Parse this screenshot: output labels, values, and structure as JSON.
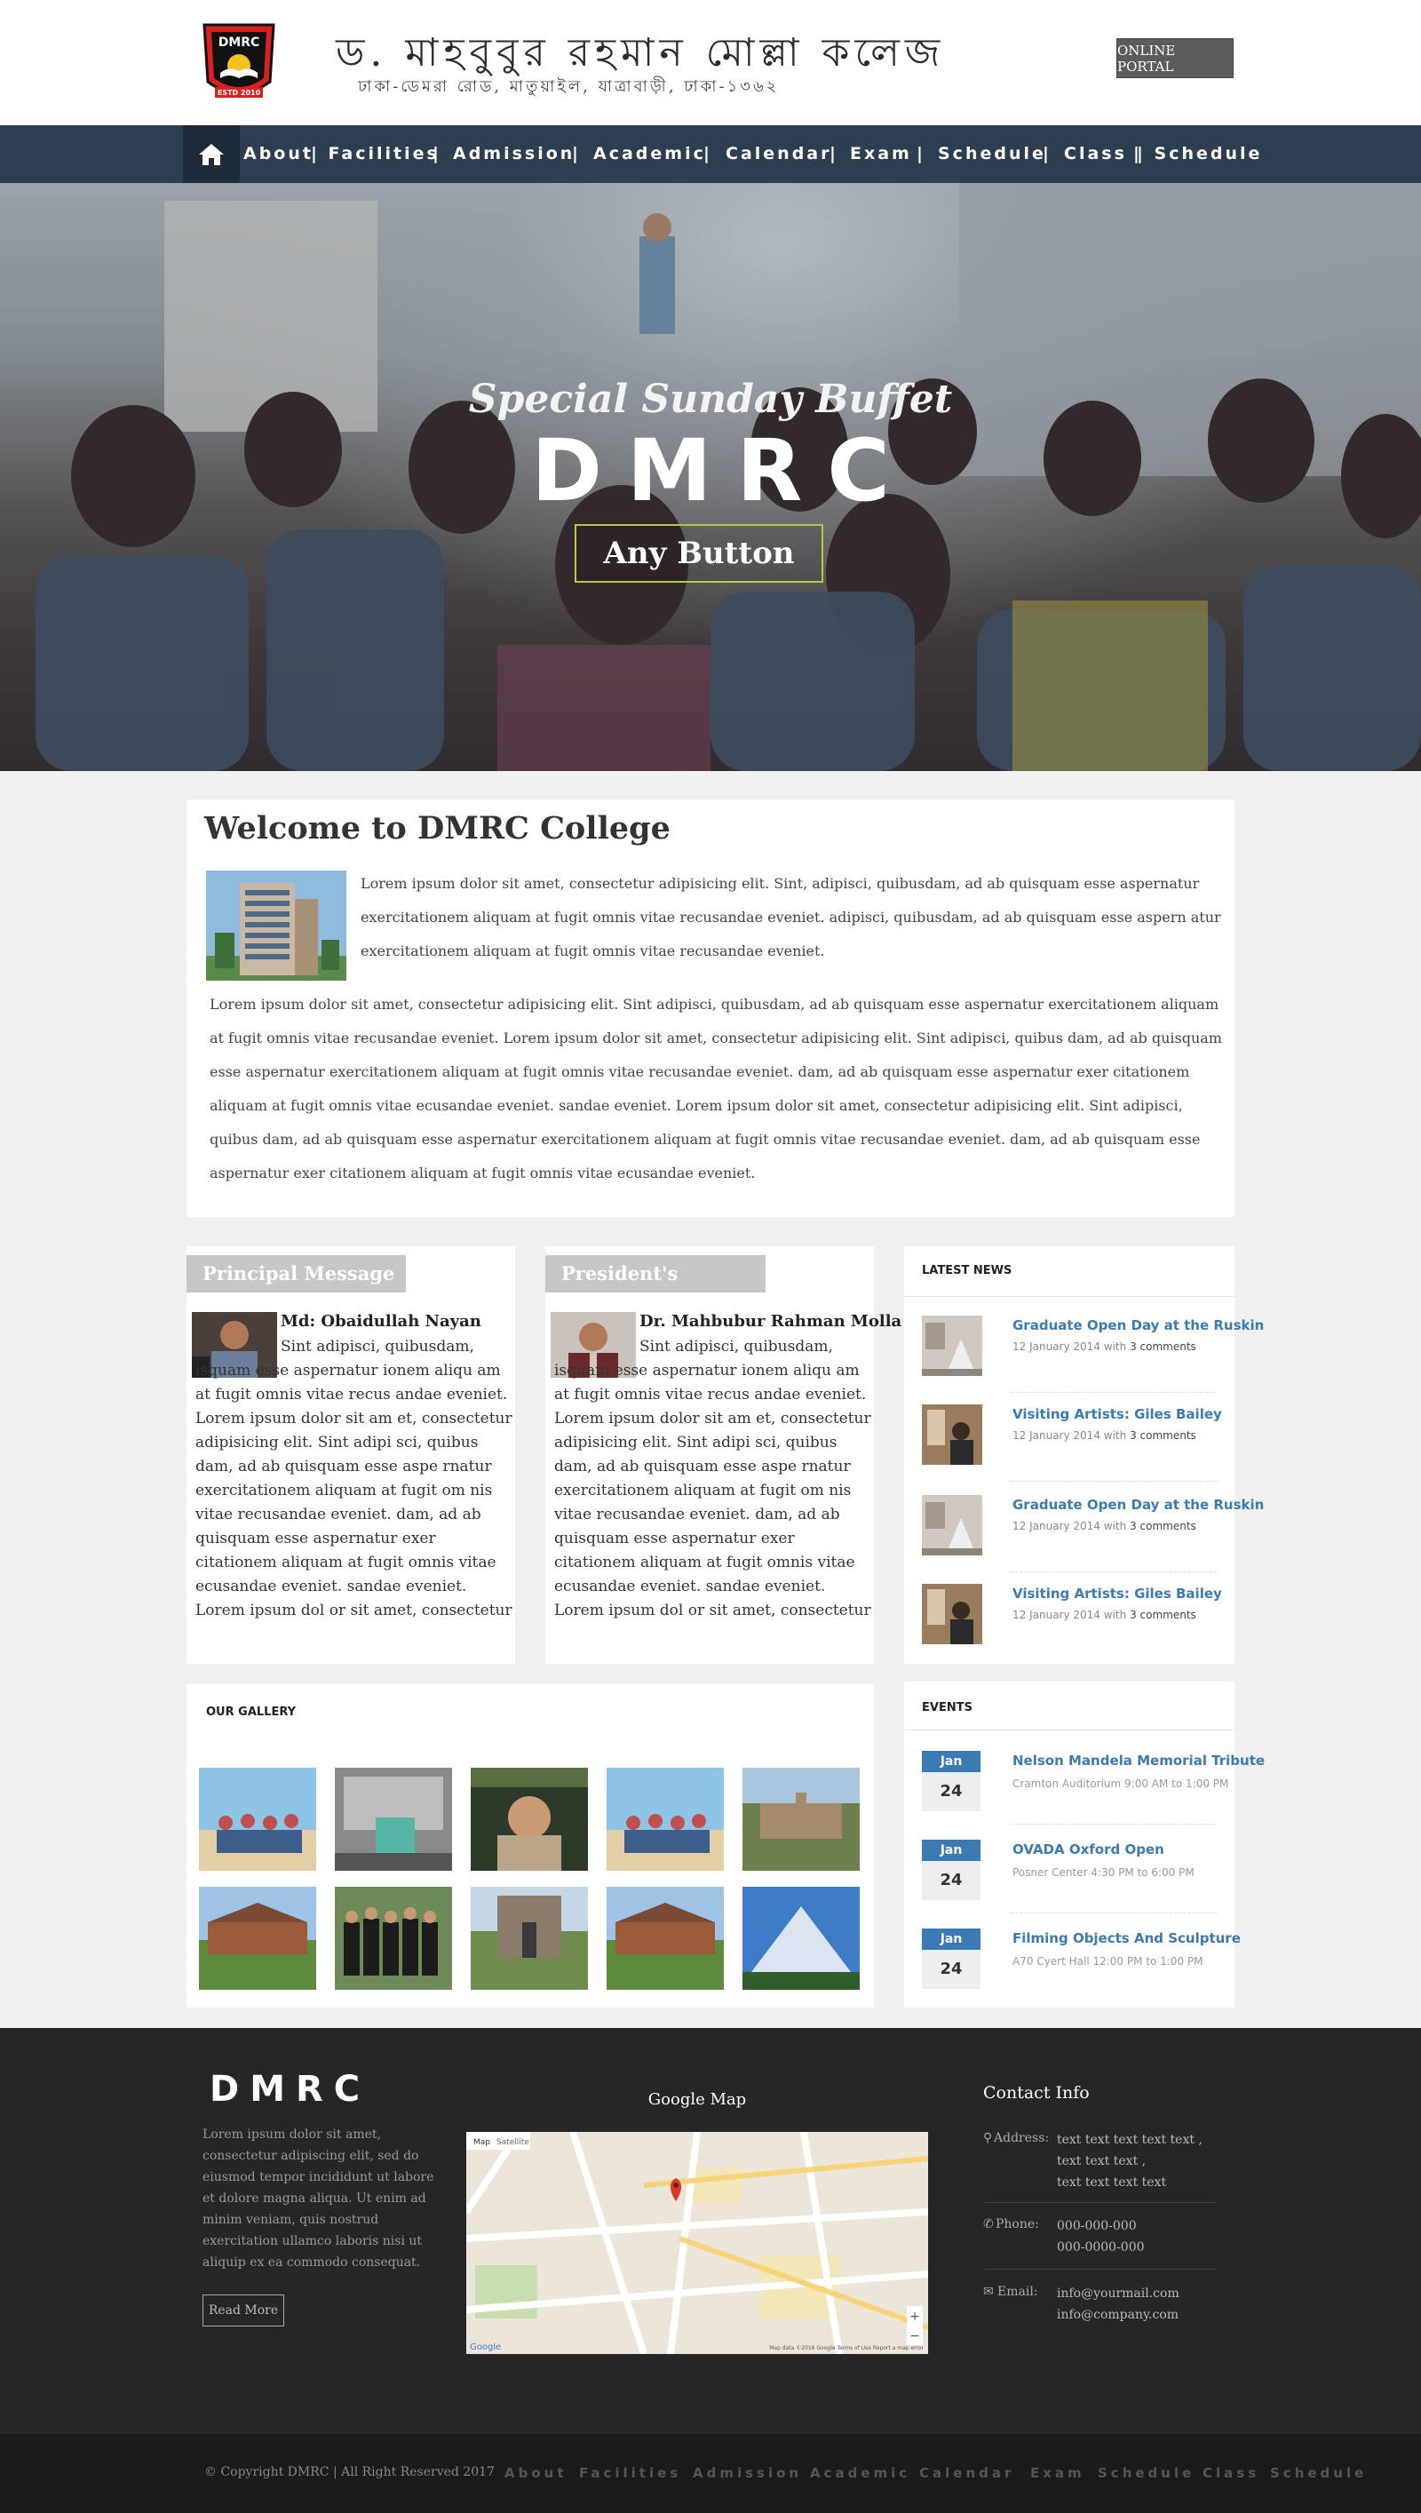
{
  "header": {
    "college_name_bn": "ড. মাহবুবুর রহমান মোল্লা কলেজ",
    "address_bn": "ঢাকা-ডেমরা রোড, মাতুয়াইল, যাত্রাবাড়ী, ঢাকা-১৩৬২",
    "logo": {
      "text": "DMRC",
      "estd": "ESTD 2010"
    },
    "portal_button": "ONLINE PORTAL"
  },
  "nav": {
    "home_icon": "home-icon",
    "items": [
      "About",
      "| Facilities",
      "|",
      "Admission",
      "|",
      "Academic",
      "|",
      "Calendar",
      "|",
      "Exam",
      "|",
      "Schedule",
      "|",
      "Class",
      "|",
      "| Schedule"
    ]
  },
  "hero": {
    "subtitle": "Special Sunday Buffet",
    "title": "DMRC",
    "button": "Any Button"
  },
  "welcome": {
    "title": "Welcome to DMRC College",
    "para1": "Lorem ipsum dolor sit amet, consectetur adipisicing elit. Sint, adipisci, quibusdam, ad ab quisquam esse aspernatur exercitationem aliquam at fugit omnis vitae recusandae eveniet. adipisci, quibusdam, ad ab quisquam esse aspern atur exercitationem aliquam at fugit omnis vitae recusandae eveniet.",
    "para2": "Lorem ipsum dolor sit amet, consectetur adipisicing elit. Sint adipisci, quibusdam, ad ab quisquam esse aspernatur exercitationem aliquam at fugit omnis vitae recusandae eveniet. Lorem ipsum dolor sit amet, consectetur adipisicing elit. Sint adipisci, quibus dam, ad ab quisquam esse aspernatur exercitationem aliquam at fugit omnis vitae  recusandae eveniet. dam, ad ab quisquam esse aspernatur exer citationem aliquam at  fugit omnis vitae ecusandae eveniet. sandae eveniet. Lorem ipsum dolor sit amet, consectetur adipisicing elit. Sint adipisci, quibus dam, ad ab quisquam esse aspernatur exercitationem aliquam at fugit omnis vitae  recusandae eveniet. dam, ad ab quisquam esse aspernatur exer citationem aliquam at  fugit omnis vitae ecusandae eveniet."
  },
  "principal": {
    "tab": "Principal Message",
    "name": "Md: Obaidullah Nayan",
    "text": "Sint adipisci, quibusdam, isquam esse aspernatur ionem aliqu am at fugit omnis vitae recus andae eveniet. Lorem ipsum dolor sit am et, consectetur adipisicing elit. Sint adipi sci, quibus dam, ad ab quisquam esse aspe rnatur exercitationem aliquam at fugit om nis vitae  recusandae eveniet. dam, ad ab quisquam esse aspernatur exer citationem aliquam at  fugit omnis vitae ecusandae eveniet. sandae eveniet. Lorem ipsum dol or sit amet, consectetur"
  },
  "president": {
    "tab": "President's message",
    "name": "Dr. Mahbubur Rahman Molla",
    "text": "Sint adipisci, quibusdam, isquam esse aspernatur ionem aliqu am at fugit omnis vitae recus andae eveniet. Lorem ipsum dolor sit am et, consectetur adipisicing elit. Sint adipi sci, quibus dam, ad ab quisquam esse aspe rnatur exercitationem aliquam at fugit om nis vitae  recusandae eveniet. dam, ad ab quisquam esse aspernatur exer citationem aliquam at  fugit omnis vitae ecusandae eveniet. sandae eveniet. Lorem ipsum dol or sit amet, consectetur"
  },
  "news": {
    "title": "LATEST NEWS",
    "items": [
      {
        "title": "Graduate Open Day at the Ruskin",
        "date": "12 January 2014",
        "with": "with",
        "comments": "3 comments"
      },
      {
        "title": "Visiting Artists: Giles Bailey",
        "date": "12 January 2014",
        "with": "with",
        "comments": "3 comments"
      },
      {
        "title": "Graduate Open Day at the Ruskin",
        "date": "12 January 2014",
        "with": "with",
        "comments": "3 comments"
      },
      {
        "title": "Visiting Artists: Giles Bailey",
        "date": "12 January 2014",
        "with": "with",
        "comments": "3 comments"
      }
    ]
  },
  "gallery": {
    "title": "OUR GALLERY"
  },
  "events": {
    "title": "EVENTS",
    "items": [
      {
        "month": "Jan",
        "day": "24",
        "title": "Nelson Mandela Memorial Tribute",
        "meta": "Cramton Auditorium 9:00 AM to 1:00 PM"
      },
      {
        "month": "Jan",
        "day": "24",
        "title": "OVADA Oxford Open",
        "meta": "Posner Center 4:30 PM to 6:00 PM"
      },
      {
        "month": "Jan",
        "day": "24",
        "title": "Filming Objects And Sculpture",
        "meta": "A70 Cyert Hall 12:00 PM to 1:00 PM"
      }
    ]
  },
  "footer": {
    "logo": "DMRC",
    "text": "Lorem ipsum dolor sit amet, consectetur adipiscing elit, sed do eiusmod tempor incididunt ut labore et dolore magna aliqua. Ut enim ad minim veniam, quis nostrud exercitation ullamco laboris nisi ut aliquip ex ea commodo consequat.",
    "read_more": "Read More",
    "map_title": "Google Map",
    "map_labels": {
      "map": "Map",
      "satellite": "Satellite",
      "google": "Google",
      "terms": "Map data ©2016 Google   Terms of Use   Report a map error"
    },
    "contact_title": "Contact Info",
    "address_label": "Address:",
    "address_lines": [
      "text text text text text ,",
      "text text text ,",
      "text text text text"
    ],
    "phone_label": "Phone:",
    "phones": [
      "000-000-000",
      "000-0000-000"
    ],
    "email_label": "Email:",
    "emails": [
      "info@yourmail.com",
      "info@company.com"
    ]
  },
  "bottom": {
    "copyright": "© Copyright DMRC | All Right Reserved 2017",
    "links": [
      "About",
      "Facilities",
      "Admission",
      "Academic",
      "Calendar",
      "Exam",
      "Schedule",
      "Class",
      "Schedule"
    ]
  },
  "colors": {
    "nav": "#2c3e50",
    "accent": "#3c7ab3",
    "footer": "#262626",
    "button_border": "#b6c94a"
  }
}
